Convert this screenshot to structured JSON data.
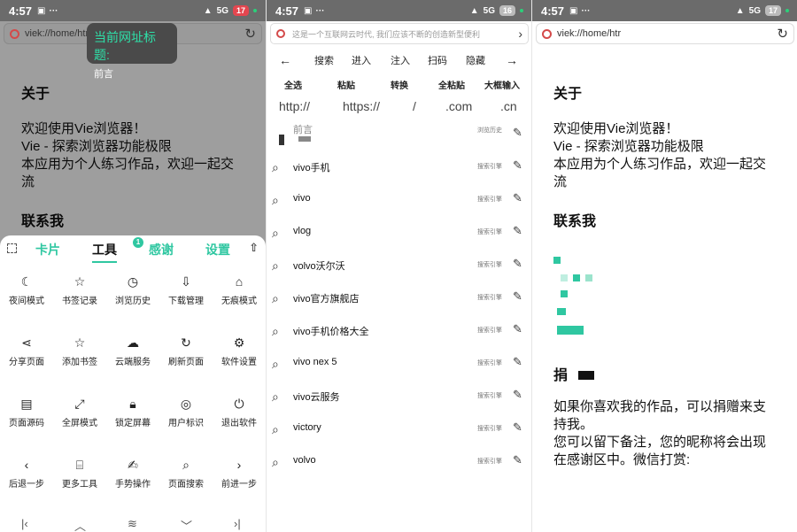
{
  "status": {
    "time_1": "4:57",
    "time_2": "4:57",
    "time_3": "4:57",
    "net_label": "5G",
    "battery_1": "17",
    "battery_2": "16",
    "battery_3": "17"
  },
  "browser": {
    "url_1": "viek://home/html/",
    "url_3": "viek://home/htr"
  },
  "tooltip": {
    "title": "当前网址标题:",
    "value": "前言"
  },
  "page": {
    "heading_about": "关于",
    "about_line1": "欢迎使用Vie浏览器！",
    "about_line2": "Vie - 探索浏览器功能极限",
    "about_line3": "本应用为个人练习作品，欢迎一起交流",
    "heading_contact": "联系我",
    "heading_donate": "捐",
    "donate_line1": "如果你喜欢我的作品，可以捐赠来支持我。",
    "donate_line2": "您可以留下备注，您的昵称将会出现在感谢区中。微信打赏:"
  },
  "sheet": {
    "tabs": [
      "卡片",
      "工具",
      "感谢",
      "设置"
    ],
    "active_tab": "工具",
    "badge": "1",
    "tools": [
      {
        "label": "夜间模式",
        "icon": "moon-icon"
      },
      {
        "label": "书签记录",
        "icon": "star-icon"
      },
      {
        "label": "浏览历史",
        "icon": "clock-icon"
      },
      {
        "label": "下载管理",
        "icon": "download-icon"
      },
      {
        "label": "无痕模式",
        "icon": "incognito-icon"
      },
      {
        "label": "分享页面",
        "icon": "share-icon"
      },
      {
        "label": "添加书签",
        "icon": "star-plus-icon"
      },
      {
        "label": "云端服务",
        "icon": "cloud-icon"
      },
      {
        "label": "刷新页面",
        "icon": "refresh-icon"
      },
      {
        "label": "软件设置",
        "icon": "gear-icon"
      },
      {
        "label": "页面源码",
        "icon": "code-icon"
      },
      {
        "label": "全屏模式",
        "icon": "fullscreen-icon"
      },
      {
        "label": "锁定屏幕",
        "icon": "lock-icon"
      },
      {
        "label": "用户标识",
        "icon": "fingerprint-icon"
      },
      {
        "label": "退出软件",
        "icon": "power-icon"
      },
      {
        "label": "后退一步",
        "icon": "back-icon"
      },
      {
        "label": "更多工具",
        "icon": "toolbox-icon"
      },
      {
        "label": "手势操作",
        "icon": "gesture-icon"
      },
      {
        "label": "页面搜索",
        "icon": "search-icon"
      },
      {
        "label": "前进一步",
        "icon": "forward-icon"
      }
    ]
  },
  "search": {
    "placeholder": "这是一个互联网云时代, 我们应该不断的创造新型便利",
    "actions": [
      "搜索",
      "进入",
      "注入",
      "扫码",
      "隐藏"
    ],
    "quick": [
      "全选",
      "粘贴",
      "转换",
      "全粘贴",
      "大框输入"
    ],
    "domain_parts": [
      "http://",
      "https://",
      "/",
      ".com",
      ".cn"
    ],
    "history_tag": "浏览历史",
    "history_text": "前言",
    "engine_tag": "搜索引擎",
    "suggestions": [
      "vivo手机",
      "vivo",
      "vlog",
      "volvo沃尔沃",
      "vivo官方旗舰店",
      "vivo手机价格大全",
      "vivo nex 5",
      "vivo云服务",
      "victory",
      "volvo"
    ]
  }
}
